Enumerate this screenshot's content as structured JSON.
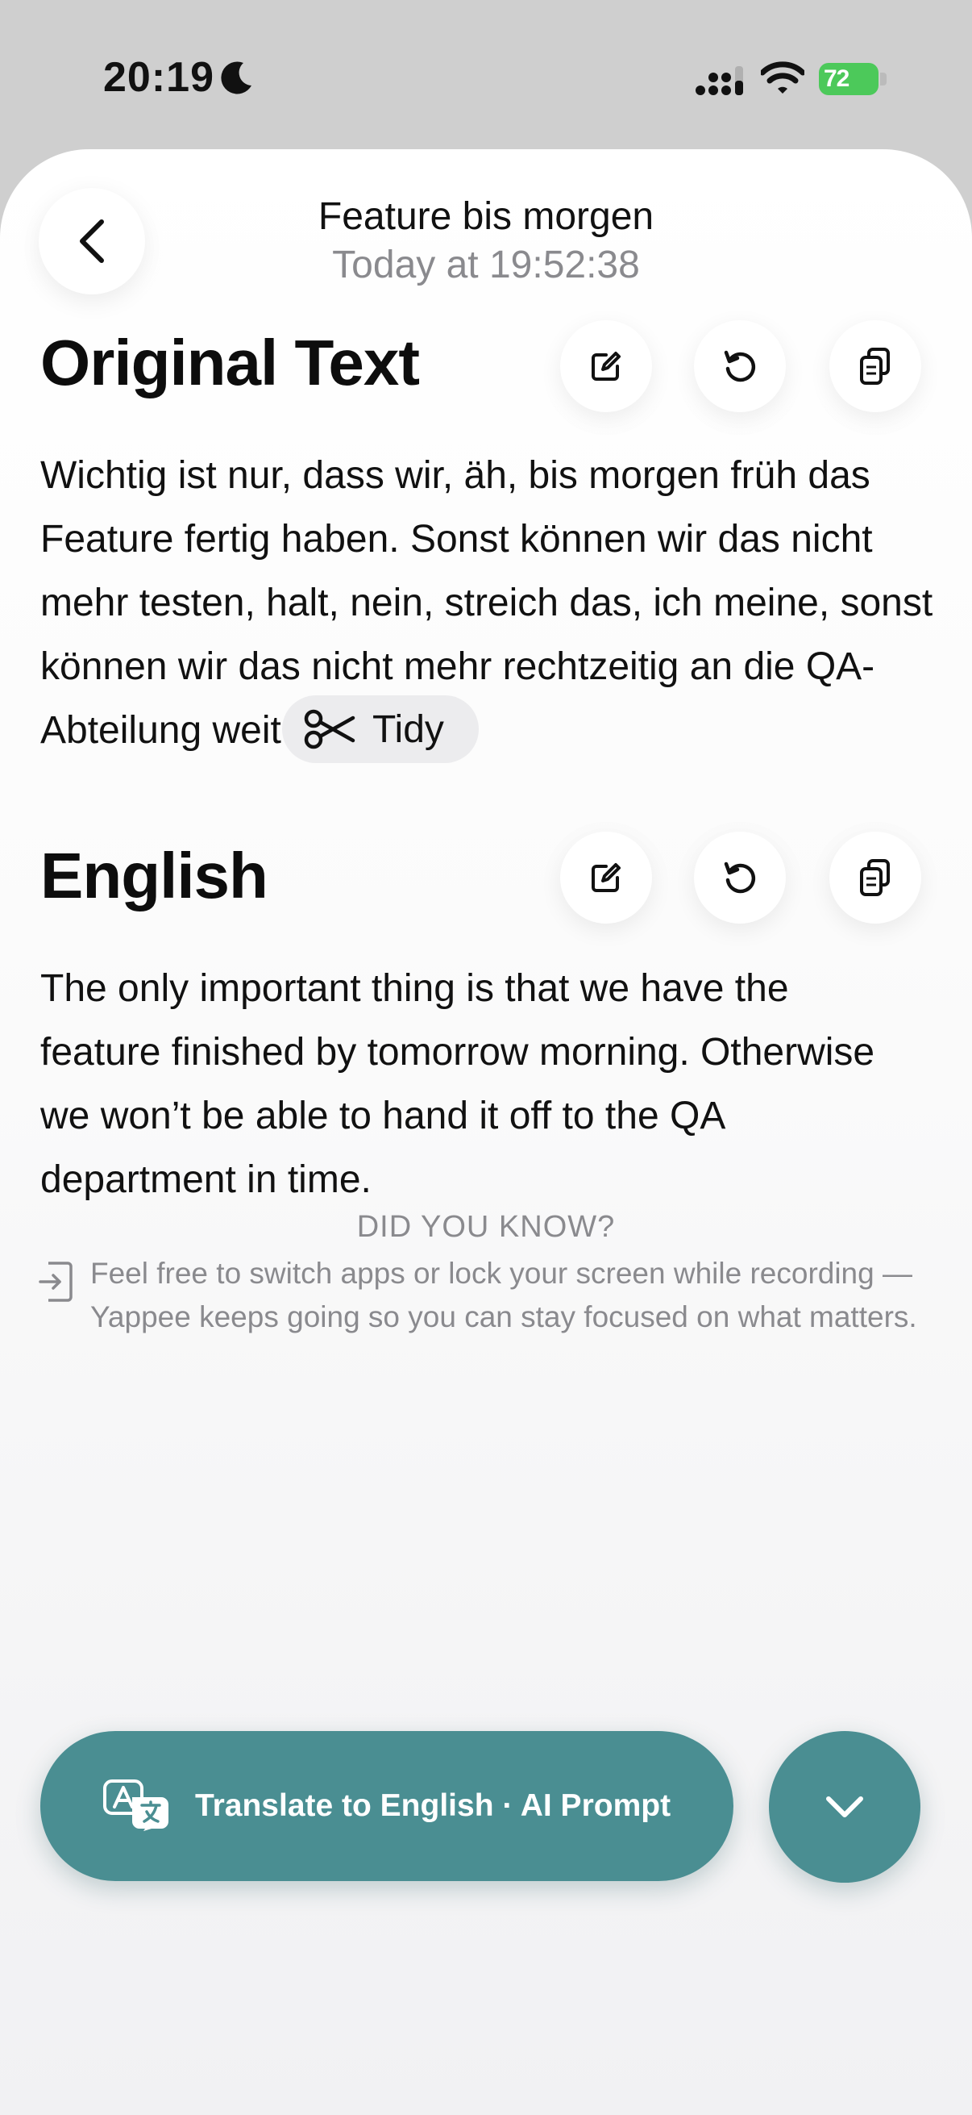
{
  "status_bar": {
    "time": "20:19",
    "battery": "72"
  },
  "header": {
    "title": "Feature bis morgen",
    "subtitle": "Today at 19:52:38"
  },
  "original": {
    "title": "Original Text",
    "text": "Wichtig ist nur, dass wir, äh, bis morgen früh das Feature fertig haben. Sonst können wir das nicht mehr testen, halt, nein, streich das, ich meine, sonst können wir das nicht mehr rechtzeitig an die QA-Abteilung weitergeben."
  },
  "translation": {
    "title": "English",
    "chip_label": "Tidy",
    "text": "The only important thing is that we have the feature finished by tomorrow morning. Otherwise we won’t be able to hand it off to the QA department in time."
  },
  "tip": {
    "heading": "DID YOU KNOW?",
    "text": "Feel free to switch apps or lock your screen while recording — Yappee keeps going so you can stay focused on what matters."
  },
  "action": {
    "label": "Translate to English · AI Prompt"
  },
  "colors": {
    "accent": "#4a8e92",
    "battery": "#4cc95a",
    "secondary_text": "#8a8a8e"
  },
  "icons": {
    "edit": "edit-icon",
    "retry": "retry-icon",
    "copy": "copy-icon",
    "back": "chevron-left-icon",
    "tidy": "scissors-icon",
    "tip": "enter-app-icon",
    "translate": "translate-icon",
    "expand": "chevron-down-icon"
  }
}
